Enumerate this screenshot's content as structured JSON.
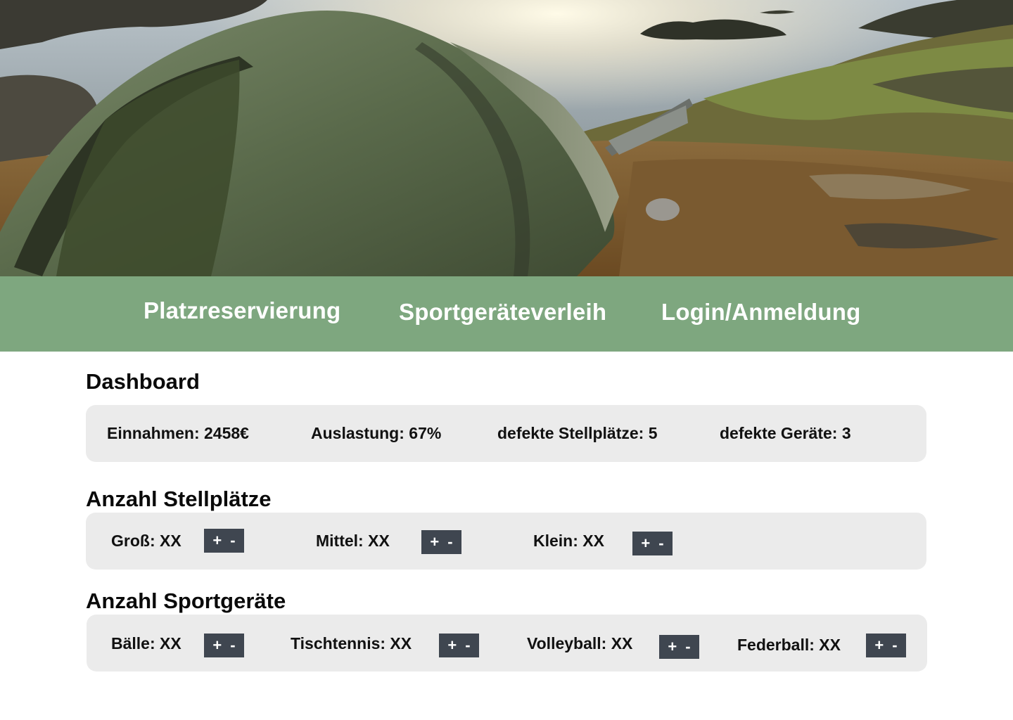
{
  "nav": {
    "items": [
      "Platzreservierung",
      "Sportgeräteverleih",
      "Login/Anmeldung"
    ]
  },
  "dashboard": {
    "title": "Dashboard",
    "stats": [
      "Einnahmen: 2458€",
      "Auslastung: 67%",
      "defekte Stellplätze: 5",
      "defekte Geräte: 3"
    ]
  },
  "stellplaetze": {
    "title": "Anzahl Stellplätze",
    "items": [
      {
        "label": "Groß: XX",
        "plus": "+",
        "minus": "-"
      },
      {
        "label": "Mittel: XX",
        "plus": "+",
        "minus": "-"
      },
      {
        "label": "Klein: XX",
        "plus": "+",
        "minus": "-"
      }
    ]
  },
  "sportgeraete": {
    "title": "Anzahl Sportgeräte",
    "items": [
      {
        "label": "Bälle: XX",
        "plus": "+",
        "minus": "-"
      },
      {
        "label": "Tischtennis: XX",
        "plus": "+",
        "minus": "-"
      },
      {
        "label": "Volleyball: XX",
        "plus": "+",
        "minus": "-"
      },
      {
        "label": "Federball: XX",
        "plus": "+",
        "minus": "-"
      }
    ]
  },
  "colors": {
    "nav_bg": "#7ea77f",
    "panel_bg": "#ebebeb",
    "stepper_bg": "#3f4650"
  }
}
